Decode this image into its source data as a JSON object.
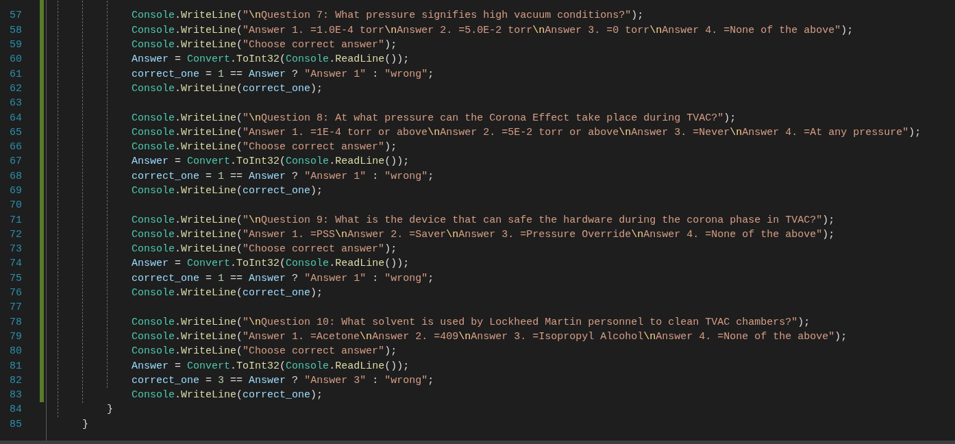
{
  "editor": {
    "lines": [
      {
        "changed": true
      },
      {
        "number": "57",
        "changed": true,
        "tokens": [
          {
            "kind": "type",
            "text": "Console"
          },
          {
            "kind": "plain",
            "text": "."
          },
          {
            "kind": "method",
            "text": "WriteLine"
          },
          {
            "kind": "plain",
            "text": "("
          },
          {
            "kind": "string",
            "text": "\""
          },
          {
            "kind": "escape",
            "text": "\\n"
          },
          {
            "kind": "string",
            "text": "Question 7: What pressure signifies high vacuum conditions?\""
          },
          {
            "kind": "plain",
            "text": ");"
          }
        ]
      },
      {
        "number": "58",
        "changed": true,
        "tokens": [
          {
            "kind": "type",
            "text": "Console"
          },
          {
            "kind": "plain",
            "text": "."
          },
          {
            "kind": "method",
            "text": "WriteLine"
          },
          {
            "kind": "plain",
            "text": "("
          },
          {
            "kind": "string",
            "text": "\"Answer 1. =1.0E-4 torr"
          },
          {
            "kind": "escape",
            "text": "\\n"
          },
          {
            "kind": "string",
            "text": "Answer 2. =5.0E-2 torr"
          },
          {
            "kind": "escape",
            "text": "\\n"
          },
          {
            "kind": "string",
            "text": "Answer 3. =0 torr"
          },
          {
            "kind": "escape",
            "text": "\\n"
          },
          {
            "kind": "string",
            "text": "Answer 4. =None of the above\""
          },
          {
            "kind": "plain",
            "text": ");"
          }
        ]
      },
      {
        "number": "59",
        "changed": true,
        "tokens": [
          {
            "kind": "type",
            "text": "Console"
          },
          {
            "kind": "plain",
            "text": "."
          },
          {
            "kind": "method",
            "text": "WriteLine"
          },
          {
            "kind": "plain",
            "text": "("
          },
          {
            "kind": "string",
            "text": "\"Choose correct answer\""
          },
          {
            "kind": "plain",
            "text": ");"
          }
        ]
      },
      {
        "number": "60",
        "changed": true,
        "tokens": [
          {
            "kind": "variable",
            "text": "Answer"
          },
          {
            "kind": "plain",
            "text": " = "
          },
          {
            "kind": "type",
            "text": "Convert"
          },
          {
            "kind": "plain",
            "text": "."
          },
          {
            "kind": "method",
            "text": "ToInt32"
          },
          {
            "kind": "plain",
            "text": "("
          },
          {
            "kind": "type",
            "text": "Console"
          },
          {
            "kind": "plain",
            "text": "."
          },
          {
            "kind": "method",
            "text": "ReadLine"
          },
          {
            "kind": "plain",
            "text": "());"
          }
        ]
      },
      {
        "number": "61",
        "changed": true,
        "tokens": [
          {
            "kind": "variable",
            "text": "correct_one"
          },
          {
            "kind": "plain",
            "text": " = "
          },
          {
            "kind": "number",
            "text": "1"
          },
          {
            "kind": "plain",
            "text": " == "
          },
          {
            "kind": "variable",
            "text": "Answer"
          },
          {
            "kind": "plain",
            "text": " ? "
          },
          {
            "kind": "string",
            "text": "\"Answer 1\""
          },
          {
            "kind": "plain",
            "text": " : "
          },
          {
            "kind": "string",
            "text": "\"wrong\""
          },
          {
            "kind": "plain",
            "text": ";"
          }
        ]
      },
      {
        "number": "62",
        "changed": true,
        "tokens": [
          {
            "kind": "type",
            "text": "Console"
          },
          {
            "kind": "plain",
            "text": "."
          },
          {
            "kind": "method",
            "text": "WriteLine"
          },
          {
            "kind": "plain",
            "text": "("
          },
          {
            "kind": "variable",
            "text": "correct_one"
          },
          {
            "kind": "plain",
            "text": ");"
          }
        ]
      },
      {
        "number": "63",
        "changed": true
      },
      {
        "number": "64",
        "changed": true,
        "tokens": [
          {
            "kind": "type",
            "text": "Console"
          },
          {
            "kind": "plain",
            "text": "."
          },
          {
            "kind": "method",
            "text": "WriteLine"
          },
          {
            "kind": "plain",
            "text": "("
          },
          {
            "kind": "string",
            "text": "\""
          },
          {
            "kind": "escape",
            "text": "\\n"
          },
          {
            "kind": "string",
            "text": "Question 8: At what pressure can the Corona Effect take place during TVAC?\""
          },
          {
            "kind": "plain",
            "text": ");"
          }
        ]
      },
      {
        "number": "65",
        "changed": true,
        "tokens": [
          {
            "kind": "type",
            "text": "Console"
          },
          {
            "kind": "plain",
            "text": "."
          },
          {
            "kind": "method",
            "text": "WriteLine"
          },
          {
            "kind": "plain",
            "text": "("
          },
          {
            "kind": "string",
            "text": "\"Answer 1. =1E-4 torr or above"
          },
          {
            "kind": "escape",
            "text": "\\n"
          },
          {
            "kind": "string",
            "text": "Answer 2. =5E-2 torr or above"
          },
          {
            "kind": "escape",
            "text": "\\n"
          },
          {
            "kind": "string",
            "text": "Answer 3. =Never"
          },
          {
            "kind": "escape",
            "text": "\\n"
          },
          {
            "kind": "string",
            "text": "Answer 4. =At any pressure\""
          },
          {
            "kind": "plain",
            "text": ");"
          }
        ]
      },
      {
        "number": "66",
        "changed": true,
        "tokens": [
          {
            "kind": "type",
            "text": "Console"
          },
          {
            "kind": "plain",
            "text": "."
          },
          {
            "kind": "method",
            "text": "WriteLine"
          },
          {
            "kind": "plain",
            "text": "("
          },
          {
            "kind": "string",
            "text": "\"Choose correct answer\""
          },
          {
            "kind": "plain",
            "text": ");"
          }
        ]
      },
      {
        "number": "67",
        "changed": true,
        "tokens": [
          {
            "kind": "variable",
            "text": "Answer"
          },
          {
            "kind": "plain",
            "text": " = "
          },
          {
            "kind": "type",
            "text": "Convert"
          },
          {
            "kind": "plain",
            "text": "."
          },
          {
            "kind": "method",
            "text": "ToInt32"
          },
          {
            "kind": "plain",
            "text": "("
          },
          {
            "kind": "type",
            "text": "Console"
          },
          {
            "kind": "plain",
            "text": "."
          },
          {
            "kind": "method",
            "text": "ReadLine"
          },
          {
            "kind": "plain",
            "text": "());"
          }
        ]
      },
      {
        "number": "68",
        "changed": true,
        "tokens": [
          {
            "kind": "variable",
            "text": "correct_one"
          },
          {
            "kind": "plain",
            "text": " = "
          },
          {
            "kind": "number",
            "text": "1"
          },
          {
            "kind": "plain",
            "text": " == "
          },
          {
            "kind": "variable",
            "text": "Answer"
          },
          {
            "kind": "plain",
            "text": " ? "
          },
          {
            "kind": "string",
            "text": "\"Answer 1\""
          },
          {
            "kind": "plain",
            "text": " : "
          },
          {
            "kind": "string",
            "text": "\"wrong\""
          },
          {
            "kind": "plain",
            "text": ";"
          }
        ]
      },
      {
        "number": "69",
        "changed": true,
        "tokens": [
          {
            "kind": "type",
            "text": "Console"
          },
          {
            "kind": "plain",
            "text": "."
          },
          {
            "kind": "method",
            "text": "WriteLine"
          },
          {
            "kind": "plain",
            "text": "("
          },
          {
            "kind": "variable",
            "text": "correct_one"
          },
          {
            "kind": "plain",
            "text": ");"
          }
        ]
      },
      {
        "number": "70",
        "changed": true
      },
      {
        "number": "71",
        "changed": true,
        "tokens": [
          {
            "kind": "type",
            "text": "Console"
          },
          {
            "kind": "plain",
            "text": "."
          },
          {
            "kind": "method",
            "text": "WriteLine"
          },
          {
            "kind": "plain",
            "text": "("
          },
          {
            "kind": "string",
            "text": "\""
          },
          {
            "kind": "escape",
            "text": "\\n"
          },
          {
            "kind": "string",
            "text": "Question 9: What is the device that can safe the hardware during the corona phase in TVAC?\""
          },
          {
            "kind": "plain",
            "text": ");"
          }
        ]
      },
      {
        "number": "72",
        "changed": true,
        "tokens": [
          {
            "kind": "type",
            "text": "Console"
          },
          {
            "kind": "plain",
            "text": "."
          },
          {
            "kind": "method",
            "text": "WriteLine"
          },
          {
            "kind": "plain",
            "text": "("
          },
          {
            "kind": "string",
            "text": "\"Answer 1. =PSS"
          },
          {
            "kind": "escape",
            "text": "\\n"
          },
          {
            "kind": "string",
            "text": "Answer 2. =Saver"
          },
          {
            "kind": "escape",
            "text": "\\n"
          },
          {
            "kind": "string",
            "text": "Answer 3. =Pressure Override"
          },
          {
            "kind": "escape",
            "text": "\\n"
          },
          {
            "kind": "string",
            "text": "Answer 4. =None of the above\""
          },
          {
            "kind": "plain",
            "text": ");"
          }
        ]
      },
      {
        "number": "73",
        "changed": true,
        "tokens": [
          {
            "kind": "type",
            "text": "Console"
          },
          {
            "kind": "plain",
            "text": "."
          },
          {
            "kind": "method",
            "text": "WriteLine"
          },
          {
            "kind": "plain",
            "text": "("
          },
          {
            "kind": "string",
            "text": "\"Choose correct answer\""
          },
          {
            "kind": "plain",
            "text": ");"
          }
        ]
      },
      {
        "number": "74",
        "changed": true,
        "tokens": [
          {
            "kind": "variable",
            "text": "Answer"
          },
          {
            "kind": "plain",
            "text": " = "
          },
          {
            "kind": "type",
            "text": "Convert"
          },
          {
            "kind": "plain",
            "text": "."
          },
          {
            "kind": "method",
            "text": "ToInt32"
          },
          {
            "kind": "plain",
            "text": "("
          },
          {
            "kind": "type",
            "text": "Console"
          },
          {
            "kind": "plain",
            "text": "."
          },
          {
            "kind": "method",
            "text": "ReadLine"
          },
          {
            "kind": "plain",
            "text": "());"
          }
        ]
      },
      {
        "number": "75",
        "changed": true,
        "tokens": [
          {
            "kind": "variable",
            "text": "correct_one"
          },
          {
            "kind": "plain",
            "text": " = "
          },
          {
            "kind": "number",
            "text": "1"
          },
          {
            "kind": "plain",
            "text": " == "
          },
          {
            "kind": "variable",
            "text": "Answer"
          },
          {
            "kind": "plain",
            "text": " ? "
          },
          {
            "kind": "string",
            "text": "\"Answer 1\""
          },
          {
            "kind": "plain",
            "text": " : "
          },
          {
            "kind": "string",
            "text": "\"wrong\""
          },
          {
            "kind": "plain",
            "text": ";"
          }
        ]
      },
      {
        "number": "76",
        "changed": true,
        "tokens": [
          {
            "kind": "type",
            "text": "Console"
          },
          {
            "kind": "plain",
            "text": "."
          },
          {
            "kind": "method",
            "text": "WriteLine"
          },
          {
            "kind": "plain",
            "text": "("
          },
          {
            "kind": "variable",
            "text": "correct_one"
          },
          {
            "kind": "plain",
            "text": ");"
          }
        ]
      },
      {
        "number": "77",
        "changed": true
      },
      {
        "number": "78",
        "changed": true,
        "tokens": [
          {
            "kind": "type",
            "text": "Console"
          },
          {
            "kind": "plain",
            "text": "."
          },
          {
            "kind": "method",
            "text": "WriteLine"
          },
          {
            "kind": "plain",
            "text": "("
          },
          {
            "kind": "string",
            "text": "\""
          },
          {
            "kind": "escape",
            "text": "\\n"
          },
          {
            "kind": "string",
            "text": "Question 10: What solvent is used by Lockheed Martin personnel to clean TVAC chambers?\""
          },
          {
            "kind": "plain",
            "text": ");"
          }
        ]
      },
      {
        "number": "79",
        "changed": true,
        "tokens": [
          {
            "kind": "type",
            "text": "Console"
          },
          {
            "kind": "plain",
            "text": "."
          },
          {
            "kind": "method",
            "text": "WriteLine"
          },
          {
            "kind": "plain",
            "text": "("
          },
          {
            "kind": "string",
            "text": "\"Answer 1. =Acetone"
          },
          {
            "kind": "escape",
            "text": "\\n"
          },
          {
            "kind": "string",
            "text": "Answer 2. =409"
          },
          {
            "kind": "escape",
            "text": "\\n"
          },
          {
            "kind": "string",
            "text": "Answer 3. =Isopropyl Alcohol"
          },
          {
            "kind": "escape",
            "text": "\\n"
          },
          {
            "kind": "string",
            "text": "Answer 4. =None of the above\""
          },
          {
            "kind": "plain",
            "text": ");"
          }
        ]
      },
      {
        "number": "80",
        "changed": true,
        "tokens": [
          {
            "kind": "type",
            "text": "Console"
          },
          {
            "kind": "plain",
            "text": "."
          },
          {
            "kind": "method",
            "text": "WriteLine"
          },
          {
            "kind": "plain",
            "text": "("
          },
          {
            "kind": "string",
            "text": "\"Choose correct answer\""
          },
          {
            "kind": "plain",
            "text": ");"
          }
        ]
      },
      {
        "number": "81",
        "changed": true,
        "tokens": [
          {
            "kind": "variable",
            "text": "Answer"
          },
          {
            "kind": "plain",
            "text": " = "
          },
          {
            "kind": "type",
            "text": "Convert"
          },
          {
            "kind": "plain",
            "text": "."
          },
          {
            "kind": "method",
            "text": "ToInt32"
          },
          {
            "kind": "plain",
            "text": "("
          },
          {
            "kind": "type",
            "text": "Console"
          },
          {
            "kind": "plain",
            "text": "."
          },
          {
            "kind": "method",
            "text": "ReadLine"
          },
          {
            "kind": "plain",
            "text": "());"
          }
        ]
      },
      {
        "number": "82",
        "changed": true,
        "tokens": [
          {
            "kind": "variable",
            "text": "correct_one"
          },
          {
            "kind": "plain",
            "text": " = "
          },
          {
            "kind": "number",
            "text": "3"
          },
          {
            "kind": "plain",
            "text": " == "
          },
          {
            "kind": "variable",
            "text": "Answer"
          },
          {
            "kind": "plain",
            "text": " ? "
          },
          {
            "kind": "string",
            "text": "\"Answer 3\""
          },
          {
            "kind": "plain",
            "text": " : "
          },
          {
            "kind": "string",
            "text": "\"wrong\""
          },
          {
            "kind": "plain",
            "text": ";"
          }
        ]
      },
      {
        "number": "83",
        "changed": true,
        "tokens": [
          {
            "kind": "type",
            "text": "Console"
          },
          {
            "kind": "plain",
            "text": "."
          },
          {
            "kind": "method",
            "text": "WriteLine"
          },
          {
            "kind": "plain",
            "text": "("
          },
          {
            "kind": "variable",
            "text": "correct_one"
          },
          {
            "kind": "plain",
            "text": ");"
          }
        ]
      },
      {
        "number": "84",
        "changed": false,
        "kind": "method_end",
        "tokens": [
          {
            "kind": "plain",
            "text": "}"
          }
        ]
      },
      {
        "number": "85",
        "changed": false,
        "kind": "class_end",
        "tokens": [
          {
            "kind": "plain",
            "text": "}"
          }
        ]
      },
      {
        "changed": false
      }
    ]
  }
}
